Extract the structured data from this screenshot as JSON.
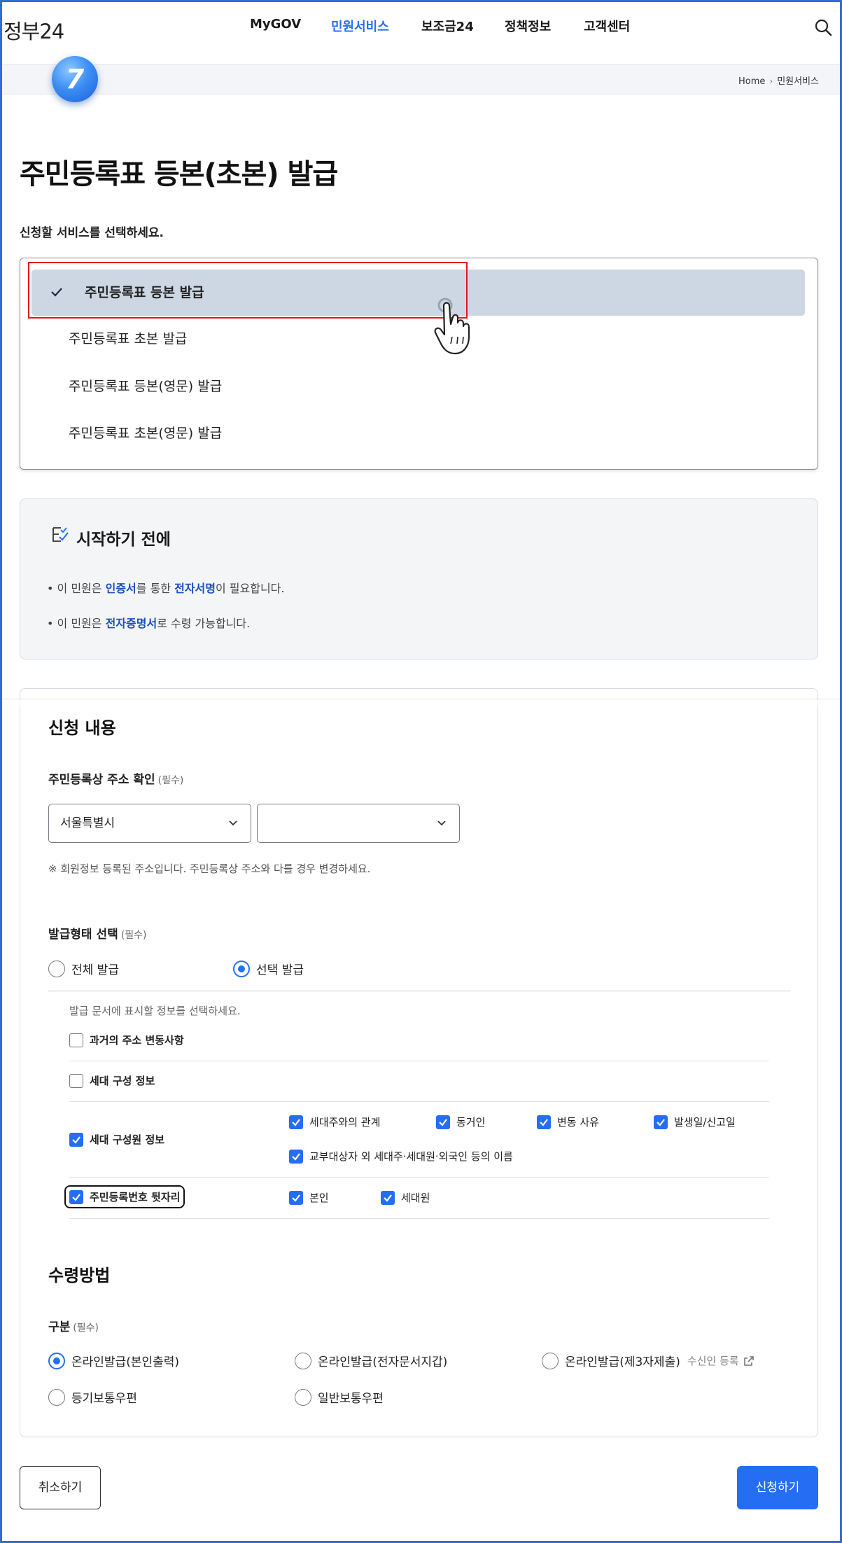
{
  "header": {
    "logo": "정부24",
    "nav": [
      "MyGOV",
      "민원서비스",
      "보조금24",
      "정책정보",
      "고객센터"
    ],
    "active_nav": "민원서비스",
    "search_icon": "search-icon"
  },
  "breadcrumb": {
    "home": "Home",
    "current": "민원서비스"
  },
  "step_badge": "7",
  "page_title": "주민등록표 등본(초본) 발급",
  "service_prompt": "신청할 서비스를 선택하세요.",
  "service_options": [
    {
      "label": "주민등록표 등본 발급",
      "selected": true
    },
    {
      "label": "주민등록표 초본 발급",
      "selected": false
    },
    {
      "label": "주민등록표 등본(영문) 발급",
      "selected": false
    },
    {
      "label": "주민등록표 초본(영문) 발급",
      "selected": false
    }
  ],
  "before_start": {
    "title": "시작하기 전에",
    "line1": {
      "a": "이 민원은 ",
      "b": "인증서",
      "c": "를 통한 ",
      "d": "전자서명",
      "e": "이 필요합니다."
    },
    "line2": {
      "a": "이 민원은 ",
      "b": "전자증명서",
      "c": "로 수령 가능합니다."
    }
  },
  "application": {
    "title": "신청 내용",
    "address_label": "주민등록상 주소 확인",
    "required": "(필수)",
    "address_select1": "서울특별시",
    "address_select2": "",
    "address_note": "※ 회원정보 등록된 주소입니다. 주민등록상 주소와 다를 경우 변경하세요.",
    "issue_type_label": "발급형태 선택",
    "issue_types": [
      {
        "label": "전체 발급",
        "checked": false
      },
      {
        "label": "선택 발급",
        "checked": true
      }
    ],
    "display_hint": "발급 문서에 표시할 정보를 선택하세요.",
    "options": {
      "past_address": {
        "label": "과거의 주소 변동사항",
        "checked": false
      },
      "household_info": {
        "label": "세대 구성 정보",
        "checked": false
      },
      "member_info": {
        "label": "세대 구성원 정보",
        "checked": true
      },
      "member_sub": [
        {
          "label": "세대주와의 관계",
          "checked": true
        },
        {
          "label": "동거인",
          "checked": true
        },
        {
          "label": "변동 사유",
          "checked": true
        },
        {
          "label": "발생일/신고일",
          "checked": true
        },
        {
          "label": "교부대상자 외 세대주·세대원·외국인 등의 이름",
          "checked": true
        }
      ],
      "rrn_back": {
        "label": "주민등록번호 뒷자리",
        "checked": true
      },
      "rrn_sub": [
        {
          "label": "본인",
          "checked": true
        },
        {
          "label": "세대원",
          "checked": true
        }
      ]
    }
  },
  "receipt": {
    "title": "수령방법",
    "category_label": "구분",
    "required": "(필수)",
    "methods": [
      {
        "label": "온라인발급(본인출력)",
        "checked": true
      },
      {
        "label": "온라인발급(전자문서지갑)",
        "checked": false
      },
      {
        "label": "온라인발급(제3자제출)",
        "checked": false,
        "extra": "수신인 등록"
      },
      {
        "label": "등기보통우편",
        "checked": false
      },
      {
        "label": "일반보통우편",
        "checked": false
      }
    ]
  },
  "buttons": {
    "cancel": "취소하기",
    "submit": "신청하기"
  },
  "colors": {
    "primary": "#256ef4",
    "highlight": "#1c4fbf",
    "selected_bg": "#cdd7e3",
    "annotation_red": "#e8141d"
  }
}
